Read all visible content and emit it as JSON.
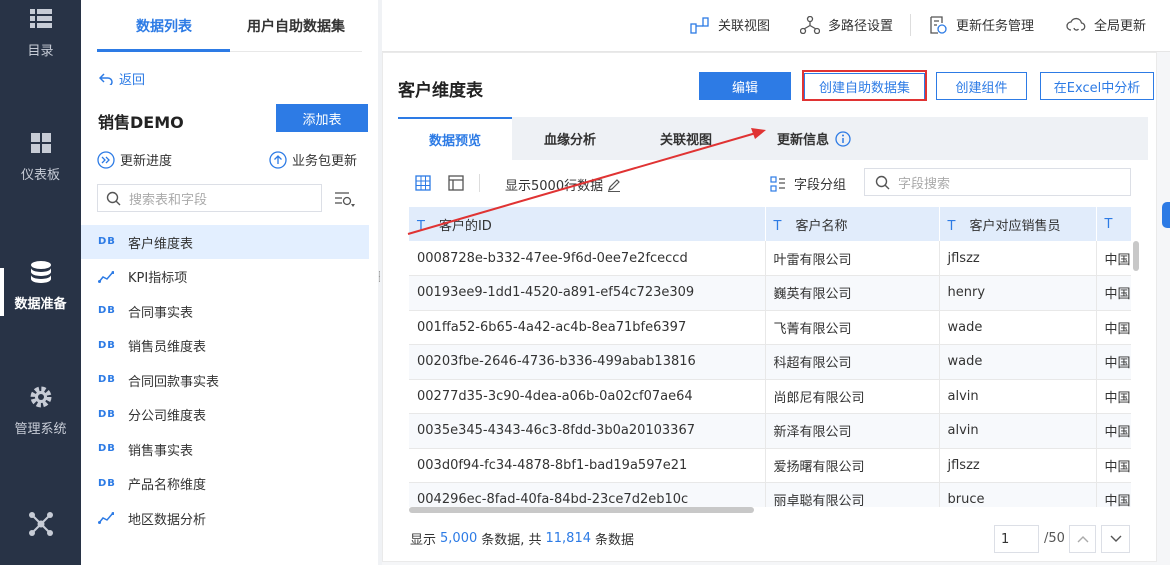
{
  "nav": {
    "items": [
      {
        "label": "目录",
        "icon": "menu-list-icon"
      },
      {
        "label": "仪表板",
        "icon": "dashboard-icon"
      },
      {
        "label": "数据准备",
        "icon": "database-icon",
        "active": true
      },
      {
        "label": "管理系统",
        "icon": "gear-icon"
      },
      {
        "label": "",
        "icon": "network-icon"
      }
    ]
  },
  "left_panel": {
    "tabs": [
      "数据列表",
      "用户自助数据集"
    ],
    "back": "返回",
    "package_title": "销售DEMO",
    "add_table": "添加表",
    "update_progress": "更新进度",
    "package_update": "业务包更新",
    "search_placeholder": "搜索表和字段",
    "tables": [
      {
        "label": "客户维度表",
        "type": "table",
        "selected": true
      },
      {
        "label": "KPI指标项",
        "type": "analysis"
      },
      {
        "label": "合同事实表",
        "type": "table"
      },
      {
        "label": "销售员维度表",
        "type": "table"
      },
      {
        "label": "合同回款事实表",
        "type": "table"
      },
      {
        "label": "分公司维度表",
        "type": "table"
      },
      {
        "label": "销售事实表",
        "type": "table"
      },
      {
        "label": "产品名称维度",
        "type": "table"
      },
      {
        "label": "地区数据分析",
        "type": "analysis"
      }
    ]
  },
  "topbar": {
    "linked_view": "关联视图",
    "multipath": "多路径设置",
    "update_task": "更新任务管理",
    "global_update": "全局更新"
  },
  "main": {
    "title": "客户维度表",
    "buttons": {
      "edit": "编辑",
      "create_dataset": "创建自助数据集",
      "create_component": "创建组件",
      "excel": "在Excel中分析"
    },
    "tabs": [
      "数据预览",
      "血缘分析",
      "关联视图",
      "更新信息"
    ],
    "show_rows": "显示5000行数据",
    "field_group": "字段分组",
    "field_search_placeholder": "字段搜索",
    "columns": [
      "客户的ID",
      "客户名称",
      "客户对应销售员",
      ""
    ],
    "rows": [
      [
        "0008728e-b332-47ee-9f6d-0ee7e2fceccd",
        "叶雷有限公司",
        "jflszz",
        "中国"
      ],
      [
        "00193ee9-1dd1-4520-a891-ef54c723e309",
        "巍英有限公司",
        "henry",
        "中国"
      ],
      [
        "001ffa52-6b65-4a42-ac4b-8ea71bfe6397",
        "飞菁有限公司",
        "wade",
        "中国"
      ],
      [
        "00203fbe-2646-4736-b336-499abab13816",
        "科超有限公司",
        "wade",
        "中国"
      ],
      [
        "00277d35-3c90-4dea-a06b-0a02cf07ae64",
        "尚郎尼有限公司",
        "alvin",
        "中国"
      ],
      [
        "0035e345-4343-46c3-8fdd-3b0a20103367",
        "新泽有限公司",
        "alvin",
        "中国"
      ],
      [
        "003d0f94-fc34-4878-8bf1-bad19a597e21",
        "爱扬曙有限公司",
        "jflszz",
        "中国"
      ],
      [
        "004296ec-8fad-40fa-84bd-23ce7d2eb10c",
        "丽卓聪有限公司",
        "bruce",
        "中国"
      ]
    ],
    "footer": {
      "prefix": "显示",
      "shown": "5,000",
      "middle": "条数据, 共",
      "total": "11,814",
      "suffix": "条数据"
    },
    "pagination": {
      "page": "1",
      "of": "/50"
    }
  },
  "colors": {
    "accent": "#2d7be5",
    "nav_bg": "#283346",
    "highlight": "#e03333"
  }
}
